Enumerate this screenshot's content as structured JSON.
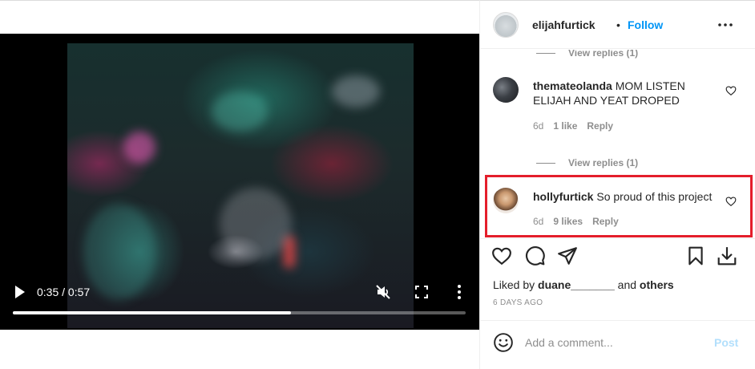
{
  "video": {
    "time_display": "0:35 / 0:57",
    "progress_fraction": 0.614,
    "controls": {
      "play_icon": "play-icon",
      "mute_icon": "muted-speaker-icon",
      "fullscreen_icon": "fullscreen-icon",
      "more_icon": "vertical-dots-icon"
    }
  },
  "post": {
    "author": "elijahfurtick",
    "separator": "•",
    "follow_label": "Follow",
    "options_icon": "horizontal-dots-icon"
  },
  "comments": {
    "view_replies_top": "View replies (1)",
    "items": [
      {
        "username": "thematеolanda",
        "text": "MOM LISTEN ELIJAH AND YEAT DROPED",
        "age": "6d",
        "likes": "1 like",
        "reply": "Reply"
      },
      {
        "username": "hollyfurtick",
        "text": "So proud of this project",
        "age": "6d",
        "likes": "9 likes",
        "reply": "Reply"
      }
    ],
    "view_replies_mid": "View replies (1)"
  },
  "actions": {
    "like_icon": "heart-icon",
    "comment_icon": "comment-bubble-icon",
    "share_icon": "paper-plane-icon",
    "save_icon": "bookmark-icon",
    "download_icon": "download-icon"
  },
  "likes": {
    "prefix": "Liked by",
    "user": "duane_______",
    "middle": "and",
    "suffix": "others"
  },
  "date": "6 DAYS AGO",
  "add_comment": {
    "placeholder": "Add a comment...",
    "post_label": "Post",
    "emoji_icon": "smiley-icon"
  },
  "colors": {
    "follow_blue": "#0095f6",
    "post_disabled_blue": "#b2dffc",
    "highlight_red": "#e41e2b",
    "secondary_text": "#8e8e8e"
  }
}
